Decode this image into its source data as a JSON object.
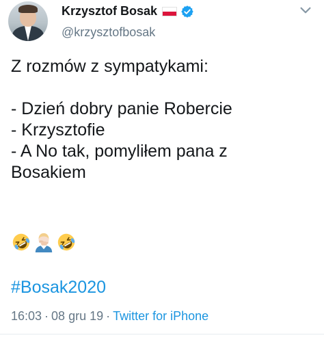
{
  "author": {
    "display_name": "Krzysztof Bosak",
    "handle": "@krzysztofbosak",
    "flag_icon": "poland-flag-icon",
    "verified_icon": "verified-badge-icon"
  },
  "tweet": {
    "lines": [
      "Z rozmów z sympatykami:",
      "",
      "- Dzień dobry panie Robercie",
      "- Krzysztofie",
      "- A No tak, pomyliłem pana z",
      "Bosakiem"
    ],
    "emojis": [
      "rolling-on-floor-laughing-emoji",
      "man-facepalming-emoji",
      "rolling-on-floor-laughing-emoji"
    ],
    "hashtag": "#Bosak2020"
  },
  "meta": {
    "time": "16:03",
    "sep1": "·",
    "date": "08 gru 19",
    "sep2": "·",
    "source": "Twitter for iPhone"
  },
  "colors": {
    "link": "#1b95e0",
    "secondary_text": "#657786",
    "primary_text": "#14171a",
    "verified": "#1da1f2"
  }
}
